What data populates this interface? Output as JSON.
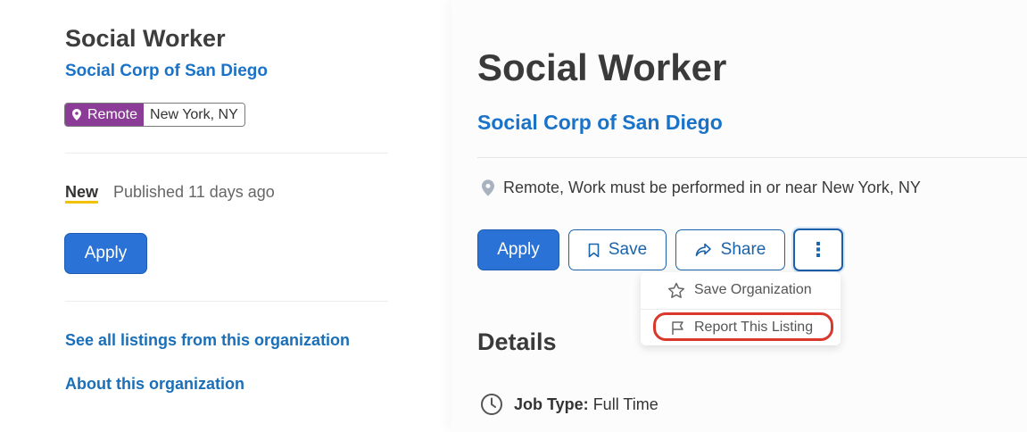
{
  "left": {
    "title": "Social Worker",
    "org": "Social Corp of San Diego",
    "badge_remote": "Remote",
    "badge_city": "New York, NY",
    "new_label": "New",
    "published": "Published 11 days ago",
    "apply_label": "Apply",
    "link_listings": "See all listings from this organization",
    "link_about": "About this organization"
  },
  "right": {
    "title": "Social Worker",
    "org": "Social Corp of San Diego",
    "location": "Remote, Work must be performed in or near New York, NY",
    "apply_label": "Apply",
    "save_label": "Save",
    "share_label": "Share",
    "more_label": "⋮",
    "menu": {
      "save_org": "Save Organization",
      "report": "Report This Listing"
    },
    "details_heading": "Details",
    "job_type_label": "Job Type:",
    "job_type_value": "Full Time"
  },
  "colors": {
    "primary": "#2b72d6",
    "link": "#1a73c8",
    "remote_badge": "#8a3c97",
    "new_underline": "#f2c200",
    "highlight": "#d9382b"
  },
  "icons": [
    "location-pin-icon",
    "bookmark-icon",
    "share-arrow-icon",
    "more-vertical-icon",
    "star-icon",
    "flag-icon",
    "clock-icon"
  ]
}
